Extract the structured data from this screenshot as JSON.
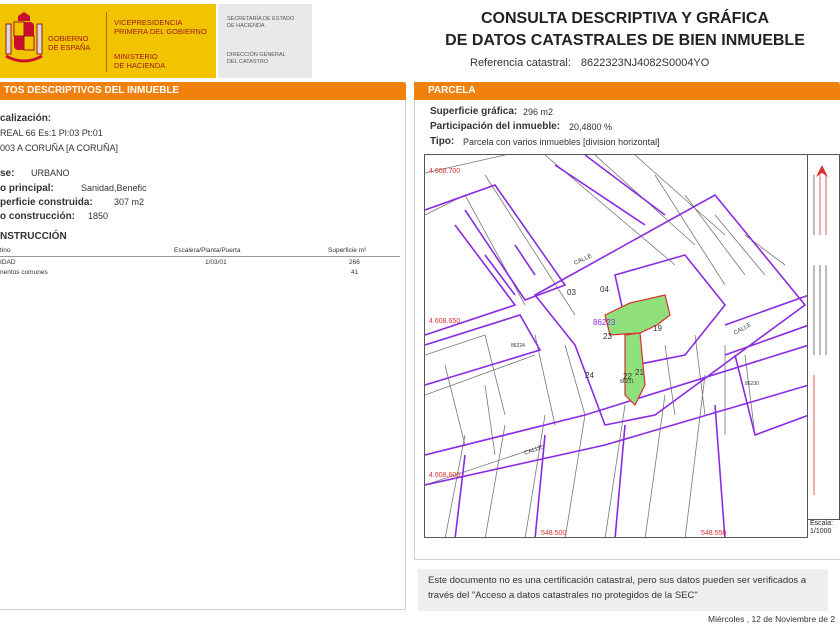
{
  "header": {
    "gov_line1": "Gobierno",
    "gov_line2": "de España",
    "vice_line1": "Vicepresidencia",
    "vice_line2": "Primera del Gobierno",
    "minis_line1": "Ministerio",
    "minis_line2": "de Hacienda",
    "sec_line1": "Secretaría de Estado",
    "sec_line2": "de Hacienda",
    "dir_line1": "Dirección General",
    "dir_line2": "del Catastro",
    "title_line1": "CONSULTA DESCRIPTIVA Y GRÁFICA",
    "title_line2": "DE DATOS CATASTRALES DE BIEN INMUEBLE",
    "ref_label": "Referencia catastral:",
    "ref_value": "8622323NJ4082S0004YO"
  },
  "left": {
    "bar": "TOS DESCRIPTIVOS DEL INMUEBLE",
    "loc_label": "calización:",
    "loc_line1": "REAL 66 Es:1 Pl:03 Pt:01",
    "loc_line2": "003 A CORUÑA [A CORUÑA]",
    "clase_label": "se:",
    "clase_value": "URBANO",
    "uso_label": "o principal:",
    "uso_value": "Sanidad,Benefic",
    "sup_label": "perficie construida:",
    "sup_value": "307 m2",
    "anio_label": "o construcción:",
    "anio_value": "1850",
    "constr_label": "NSTRUCCIÓN",
    "table": {
      "col1": "tino",
      "col2": "Escalera/Planta/Puerta",
      "col3": "Superficie m²",
      "rows": [
        {
          "c1": "IDAD",
          "c2": "1/03/01",
          "c3": "266"
        },
        {
          "c1": "nentos comunes",
          "c2": "",
          "c3": "41"
        }
      ]
    }
  },
  "right": {
    "bar": "PARCELA",
    "supg_label": "Superficie gráfica:",
    "supg_value": "296 m2",
    "part_label": "Participación del inmueble:",
    "part_value": "20,4800 %",
    "tipo_label": "Tipo:",
    "tipo_value": "Parcela con varios inmuebles [division horizontal]",
    "map": {
      "labels": {
        "y_top": "4.608.700",
        "y_mid": "4.608.650",
        "y_low": "4.608.600",
        "x_left": "548.500",
        "x_right": "548.550",
        "n03": "03",
        "n04": "04",
        "n23": "23",
        "n19": "19",
        "n24": "24",
        "n22": "22",
        "n21": "21",
        "parcel_code": "86223",
        "blk1": "86224",
        "blk2": "86231",
        "blk3": "86230",
        "calle": "CALLE"
      }
    },
    "escala_label": "Escala:",
    "escala_value": "1/1000"
  },
  "footer": {
    "note_line1": "Este documento no es una certificación catastral, pero sus datos pueden ser verificados a",
    "note_line2": "través del \"Acceso a datos catastrales no protegidos de la SEC\"",
    "date": "Miércoles , 12 de Noviembre de 2"
  },
  "colors": {
    "accent_orange": "#f0810f",
    "gov_yellow": "#f2c400",
    "gov_red": "#a0171c",
    "parcel_purple": "#8a2be2",
    "parcel_green": "#8fe07a"
  }
}
